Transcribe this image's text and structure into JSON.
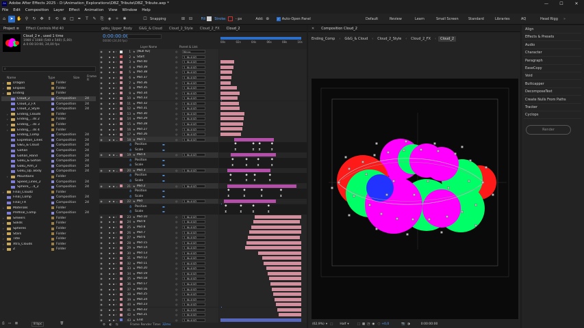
{
  "app": {
    "title": "Adobe After Effects 2025 - D:\\Animation_Explorations\\DBZ_Tribute\\DBZ_Tribute.aep *",
    "window_controls": [
      "—",
      "☐",
      "✕"
    ]
  },
  "menu": [
    "File",
    "Edit",
    "Composition",
    "Layer",
    "Effect",
    "Animation",
    "View",
    "Window",
    "Help"
  ],
  "toolbar": {
    "snapping": "Snapping",
    "fill": "Fill",
    "stroke": "Stroke:",
    "stroke_px": "- px",
    "add": "Add:",
    "auto_open": "Auto-Open Panel"
  },
  "workspaces": [
    "Default",
    "Review",
    "Learn",
    "Small Screen",
    "Standard",
    "Libraries",
    "AQ",
    "Head Rigg"
  ],
  "project": {
    "tabs": [
      "Project ≡",
      "Effect Controls Mid 40"
    ],
    "comp_name": "Cloud_2 ▾ , used 1 time",
    "comp_res": "1980 x 1080 (540 x 540) (1,00)",
    "comp_dur": "Δ 0:00:10:00, 24,00 fps",
    "search_placeholder": "⌕",
    "headers": {
      "name": "Name",
      "type": "Type",
      "size": "Size",
      "fr": "Frame R"
    },
    "items": [
      {
        "name": "Dragon",
        "type": "Folder",
        "kind": "folder",
        "d": 0
      },
      {
        "name": "Ellipses",
        "type": "Folder",
        "kind": "folder",
        "d": 0
      },
      {
        "name": "Ending",
        "type": "Folder",
        "kind": "folder",
        "d": 0
      },
      {
        "name": "Cloud_2",
        "type": "Composition",
        "fr": "24",
        "kind": "comp",
        "d": 1,
        "sel": true
      },
      {
        "name": "Cloud_2_FX",
        "type": "Composition",
        "fr": "24",
        "kind": "comp",
        "d": 1
      },
      {
        "name": "Cloud_2_Style",
        "type": "Composition",
        "fr": "24",
        "kind": "comp",
        "d": 1
      },
      {
        "name": "Ending_Clouds",
        "type": "Folder",
        "kind": "folder",
        "d": 1
      },
      {
        "name": "Ending_...ds 2",
        "type": "Folder",
        "kind": "folder",
        "d": 1
      },
      {
        "name": "Ending_...ds 3",
        "type": "Folder",
        "kind": "folder",
        "d": 1
      },
      {
        "name": "Ending_...ds 4",
        "type": "Folder",
        "kind": "folder",
        "d": 1
      },
      {
        "name": "Ending_Comp",
        "type": "Composition",
        "fr": "24",
        "kind": "comp",
        "d": 1
      },
      {
        "name": "Expretion_Lines",
        "type": "Composition",
        "fr": "24",
        "kind": "comp",
        "d": 1
      },
      {
        "name": "G&G_& Cloud",
        "type": "Composition",
        "fr": "24",
        "kind": "comp",
        "d": 1
      },
      {
        "name": "Gohan",
        "type": "Composition",
        "fr": "24",
        "kind": "comp",
        "d": 1
      },
      {
        "name": "Gohan_Hand",
        "type": "Composition",
        "fr": "24",
        "kind": "comp",
        "d": 1
      },
      {
        "name": "Goku_& Gohan",
        "type": "Composition",
        "fr": "24",
        "kind": "comp",
        "d": 1
      },
      {
        "name": "Goku_Arm_2",
        "type": "Composition",
        "fr": "24",
        "kind": "comp",
        "d": 1
      },
      {
        "name": "Goku_Up..Body",
        "type": "Composition",
        "fr": "24",
        "kind": "comp",
        "d": 1
      },
      {
        "name": "Mountains",
        "type": "Folder",
        "kind": "folder",
        "d": 1
      },
      {
        "name": "Speed_Lines_2",
        "type": "Composition",
        "fr": "24",
        "kind": "comp",
        "d": 1
      },
      {
        "name": "Sphere_...4_2",
        "type": "Composition",
        "fr": "24",
        "kind": "comp",
        "d": 1
      },
      {
        "name": "Final_Cloudz",
        "type": "Folder",
        "kind": "folder",
        "d": 0
      },
      {
        "name": "Final_Comp",
        "type": "Composition",
        "fr": "24",
        "kind": "comp",
        "d": 0
      },
      {
        "name": "Final_FX",
        "type": "Composition",
        "fr": "24",
        "kind": "comp",
        "d": 0
      },
      {
        "name": "Materials",
        "type": "Folder",
        "kind": "folder",
        "d": 0
      },
      {
        "name": "Prefinal_Comp",
        "type": "Composition",
        "fr": "24",
        "kind": "comp",
        "d": 0
      },
      {
        "name": "Smeers",
        "type": "Folder",
        "kind": "folder",
        "d": 0
      },
      {
        "name": "Solids",
        "type": "Folder",
        "kind": "folder",
        "d": 0
      },
      {
        "name": "Spheres",
        "type": "Folder",
        "kind": "folder",
        "d": 0
      },
      {
        "name": "Stars",
        "type": "Folder",
        "kind": "folder",
        "d": 0
      },
      {
        "name": "Title",
        "type": "Folder",
        "kind": "folder",
        "d": 0
      },
      {
        "name": "Xtra_Clouds",
        "type": "Folder",
        "kind": "folder",
        "d": 0
      },
      {
        "name": "Z",
        "type": "Folder",
        "kind": "folder",
        "d": 0
      }
    ],
    "bpc": "8 bpc"
  },
  "timeline": {
    "tabs": [
      "goku_Upper_Body",
      "G&G_& Cloud",
      "Cloud_2_Style",
      "Cloud_2_FX",
      "Cloud_2"
    ],
    "time": "0:00:00:00",
    "sub": "00000 (24,00 fps)",
    "col_name": "Layer Name",
    "col_parent": "Parent & Link",
    "ruler": [
      "00s",
      "02s",
      "04s",
      "06s",
      "08s",
      "10s"
    ],
    "footer": "Frame Render Time:",
    "footer_val": "32ms",
    "layers": [
      {
        "n": "1",
        "name": "[Null 92]",
        "p": "None",
        "c": "#e0e0e0"
      },
      {
        "n": "2",
        "name": "Start",
        "p": "1. Null 92",
        "c": "#ff6666"
      },
      {
        "n": "3",
        "name": "Mid 40",
        "p": "1. Null 92",
        "c": "#d48f9e",
        "b": [
          0,
          20
        ]
      },
      {
        "n": "4",
        "name": "Mid 39",
        "p": "1. Null 92",
        "c": "#d48f9e",
        "b": [
          0,
          19
        ]
      },
      {
        "n": "5",
        "name": "Mid 38",
        "p": "1. Null 92",
        "c": "#d48f9e",
        "b": [
          0,
          17
        ]
      },
      {
        "n": "6",
        "name": "Mid 37",
        "p": "1. Null 92",
        "c": "#d48f9e",
        "b": [
          0,
          16
        ]
      },
      {
        "n": "7",
        "name": "Mid 36",
        "p": "1. Null 92",
        "c": "#d48f9e",
        "b": [
          0,
          15
        ]
      },
      {
        "n": "8",
        "name": "Mid 35",
        "p": "1. Null 92",
        "c": "#d48f9e",
        "b": [
          0,
          24
        ]
      },
      {
        "n": "9",
        "name": "Mid 34",
        "p": "1. Null 92",
        "c": "#d48f9e",
        "b": [
          0,
          28
        ]
      },
      {
        "n": "10",
        "name": "Mid 33",
        "p": "1. Null 92",
        "c": "#d48f9e",
        "b": [
          0,
          25
        ]
      },
      {
        "n": "11",
        "name": "Mid 32",
        "p": "1. Null 92",
        "c": "#d48f9e",
        "b": [
          0,
          27
        ]
      },
      {
        "n": "12",
        "name": "Mid 31",
        "p": "1. Null 92",
        "c": "#d48f9e",
        "b": [
          0,
          28
        ]
      },
      {
        "n": "13",
        "name": "Mid 30",
        "p": "1. Null 92",
        "c": "#d48f9e",
        "b": [
          0,
          35
        ]
      },
      {
        "n": "14",
        "name": "Mid 29",
        "p": "1. Null 92",
        "c": "#d48f9e",
        "b": [
          0,
          34
        ]
      },
      {
        "n": "15",
        "name": "Mid 28",
        "p": "1. Null 92",
        "c": "#d48f9e",
        "b": [
          0,
          33
        ]
      },
      {
        "n": "16",
        "name": "Mid 27",
        "p": "1. Null 92",
        "c": "#d48f9e",
        "b": [
          0,
          32
        ]
      },
      {
        "n": "17",
        "name": "Mid 26",
        "p": "1. Null 92",
        "c": "#d48f9e",
        "b": [
          0,
          30
        ]
      },
      {
        "n": "18",
        "name": "Mid 5",
        "p": "1. Null 92",
        "c": "#d48f9e",
        "b": [
          20,
          77
        ],
        "bc": "#b34fa8",
        "open": true
      },
      {
        "prop": "Position",
        "k": [
          22,
          48,
          57,
          75
        ]
      },
      {
        "prop": "Scale",
        "k": [
          22,
          48,
          57,
          75
        ],
        "ek": true
      },
      {
        "n": "19",
        "name": "Mid 4",
        "p": "1. Null 92",
        "c": "#d48f9e",
        "b": [
          15,
          80
        ],
        "bc": "#b34fa8",
        "open": true
      },
      {
        "prop": "Position",
        "k": [
          18,
          38,
          55,
          75
        ]
      },
      {
        "prop": "Scale",
        "k": [
          18,
          38,
          55,
          75
        ],
        "ek": true
      },
      {
        "n": "20",
        "name": "Mid 3",
        "p": "1. Null 92",
        "c": "#d48f9e",
        "b": [
          10,
          72
        ],
        "bc": "#b34fa8",
        "open": true
      },
      {
        "prop": "Position",
        "k": [
          15,
          38,
          50,
          72
        ]
      },
      {
        "prop": "Scale",
        "k": [
          15,
          38,
          50,
          72
        ],
        "ek": true
      },
      {
        "n": "21",
        "name": "Mid 2",
        "p": "1. Null 92",
        "c": "#d48f9e",
        "b": [
          10,
          110
        ],
        "bc": "#b34fa8",
        "open": true
      },
      {
        "prop": "Position",
        "k": [
          12,
          35,
          60,
          88
        ]
      },
      {
        "prop": "Scale",
        "k": [
          12,
          35,
          60,
          88
        ],
        "ek": true
      },
      {
        "n": "22",
        "name": "Mid",
        "p": "1. Null 92",
        "c": "#d48f9e",
        "b": [
          5,
          80
        ],
        "bc": "#b34fa8",
        "open": true
      },
      {
        "prop": "Position",
        "k": [
          8,
          30,
          48,
          70
        ]
      },
      {
        "prop": "Scale",
        "k": [
          8,
          30,
          48,
          70
        ],
        "ek": true
      },
      {
        "n": "23",
        "name": "Mid 10",
        "p": "1. Null 92",
        "c": "#d48f9e",
        "b": [
          50,
          117
        ]
      },
      {
        "n": "24",
        "name": "Mid 9",
        "p": "1. Null 92",
        "c": "#d48f9e",
        "b": [
          48,
          115
        ]
      },
      {
        "n": "25",
        "name": "Mid 8",
        "p": "1. Null 92",
        "c": "#d48f9e",
        "b": [
          45,
          117
        ]
      },
      {
        "n": "26",
        "name": "Mid 7",
        "p": "1. Null 92",
        "c": "#d48f9e",
        "b": [
          42,
          117
        ]
      },
      {
        "n": "27",
        "name": "Mid 6",
        "p": "1. Null 92",
        "c": "#d48f9e",
        "b": [
          40,
          115
        ]
      },
      {
        "n": "28",
        "name": "Mid 15",
        "p": "1. Null 92",
        "c": "#d48f9e",
        "b": [
          38,
          117
        ]
      },
      {
        "n": "29",
        "name": "Mid 14",
        "p": "1. Null 92",
        "c": "#d48f9e",
        "b": [
          36,
          117
        ]
      },
      {
        "n": "30",
        "name": "Mid 13",
        "p": "1. Null 92",
        "c": "#d48f9e",
        "b": [
          55,
          117
        ]
      },
      {
        "n": "31",
        "name": "Mid 12",
        "p": "1. Null 92",
        "c": "#d48f9e",
        "b": [
          60,
          117
        ]
      },
      {
        "n": "32",
        "name": "Mid 11",
        "p": "1. Null 92",
        "c": "#d48f9e",
        "b": [
          62,
          117
        ]
      },
      {
        "n": "33",
        "name": "Mid 20",
        "p": "1. Null 92",
        "c": "#d48f9e",
        "b": [
          66,
          117
        ]
      },
      {
        "n": "34",
        "name": "Mid 19",
        "p": "1. Null 92",
        "c": "#d48f9e",
        "b": [
          68,
          117
        ]
      },
      {
        "n": "35",
        "name": "Mid 18",
        "p": "1. Null 92",
        "c": "#d48f9e",
        "b": [
          70,
          117
        ]
      },
      {
        "n": "36",
        "name": "Mid 17",
        "p": "1. Null 92",
        "c": "#d48f9e",
        "b": [
          72,
          117
        ]
      },
      {
        "n": "37",
        "name": "Mid 16",
        "p": "1. Null 92",
        "c": "#d48f9e",
        "b": [
          74,
          117
        ]
      },
      {
        "n": "38",
        "name": "Mid 25",
        "p": "1. Null 92",
        "c": "#d48f9e",
        "b": [
          76,
          117
        ]
      },
      {
        "n": "39",
        "name": "Mid 24",
        "p": "1. Null 92",
        "c": "#d48f9e",
        "b": [
          78,
          117
        ]
      },
      {
        "n": "40",
        "name": "Mid 23",
        "p": "1. Null 92",
        "c": "#d48f9e",
        "b": [
          80,
          117
        ]
      },
      {
        "n": "41",
        "name": "Mid 22",
        "p": "1. Null 92",
        "c": "#d48f9e",
        "b": [
          82,
          117
        ]
      },
      {
        "n": "42",
        "name": "Mid 21",
        "p": "1. Null 92",
        "c": "#d48f9e",
        "b": [
          84,
          117
        ]
      },
      {
        "n": "43",
        "name": "End",
        "p": "1. Null 92",
        "c": "#6677cc",
        "b": [
          0,
          117
        ],
        "bc": "#5566bb"
      }
    ]
  },
  "composition": {
    "tab": "Composition Cloud_2",
    "breadcrumbs": [
      "Ending_Comp",
      "G&G_& Cloud",
      "Cloud_2_Style",
      "Cloud_2_FX",
      "Cloud_2"
    ],
    "zoom": "(62,9%)",
    "res": "Half",
    "exposure": "+0,0",
    "time": "0:00:00:00"
  },
  "right_panel": {
    "items": [
      "Align",
      "Effects & Presets",
      "Audio",
      "Character",
      "Paragraph",
      "EaseCopy",
      "Void",
      "Buttcapper",
      "DecomposeText",
      "Create Nulls From Paths",
      "Tracker",
      "Cyclops"
    ],
    "render": "Render"
  }
}
